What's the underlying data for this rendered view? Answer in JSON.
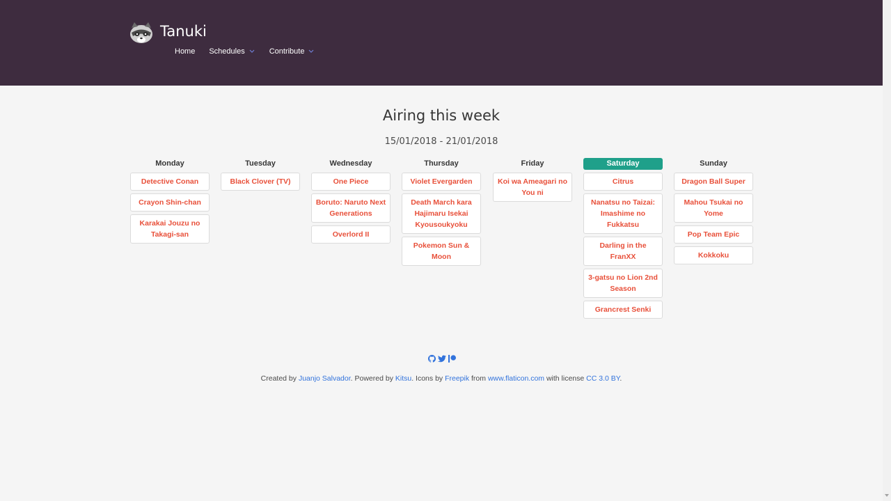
{
  "app": {
    "brand": "Tanuki"
  },
  "nav": {
    "home": "Home",
    "schedules": "Schedules",
    "contribute": "Contribute"
  },
  "main": {
    "title": "Airing this week",
    "date_range": "15/01/2018 - 21/01/2018"
  },
  "days": [
    {
      "name": "Monday",
      "today": false,
      "shows": [
        "Detective Conan",
        "Crayon Shin-chan",
        "Karakai Jouzu no Takagi-san"
      ]
    },
    {
      "name": "Tuesday",
      "today": false,
      "shows": [
        "Black Clover (TV)"
      ]
    },
    {
      "name": "Wednesday",
      "today": false,
      "shows": [
        "One Piece",
        "Boruto: Naruto Next Generations",
        "Overlord II"
      ]
    },
    {
      "name": "Thursday",
      "today": false,
      "shows": [
        "Violet Evergarden",
        "Death March kara Hajimaru Isekai Kyousoukyoku",
        "Pokemon Sun & Moon"
      ]
    },
    {
      "name": "Friday",
      "today": false,
      "shows": [
        "Koi wa Ameagari no You ni"
      ]
    },
    {
      "name": "Saturday",
      "today": true,
      "shows": [
        "Citrus",
        "Nanatsu no Taizai: Imashime no Fukkatsu",
        "Darling in the FranXX",
        "3-gatsu no Lion 2nd Season",
        "Grancrest Senki"
      ]
    },
    {
      "name": "Sunday",
      "today": false,
      "shows": [
        "Dragon Ball Super",
        "Mahou Tsukai no Yome",
        "Pop Team Epic",
        "Kokkoku"
      ]
    }
  ],
  "footer": {
    "icons": [
      "github-icon",
      "twitter-icon",
      "patreon-icon"
    ],
    "created_by": "Created by ",
    "author": "Juanjo Salvador",
    "powered_by": ". Powered by ",
    "powered_link": "Kitsu",
    "icons_by": ". Icons by ",
    "icons_link": "Freepik",
    "from": " from ",
    "from_link": "www.flaticon.com",
    "license_text": " with license ",
    "license_link": "CC 3.0 BY",
    "end": "."
  },
  "colors": {
    "header_bg": "#3e2c3f",
    "today_bg": "#1fa08a",
    "show_text": "#e8503a",
    "link": "#3273dc"
  }
}
